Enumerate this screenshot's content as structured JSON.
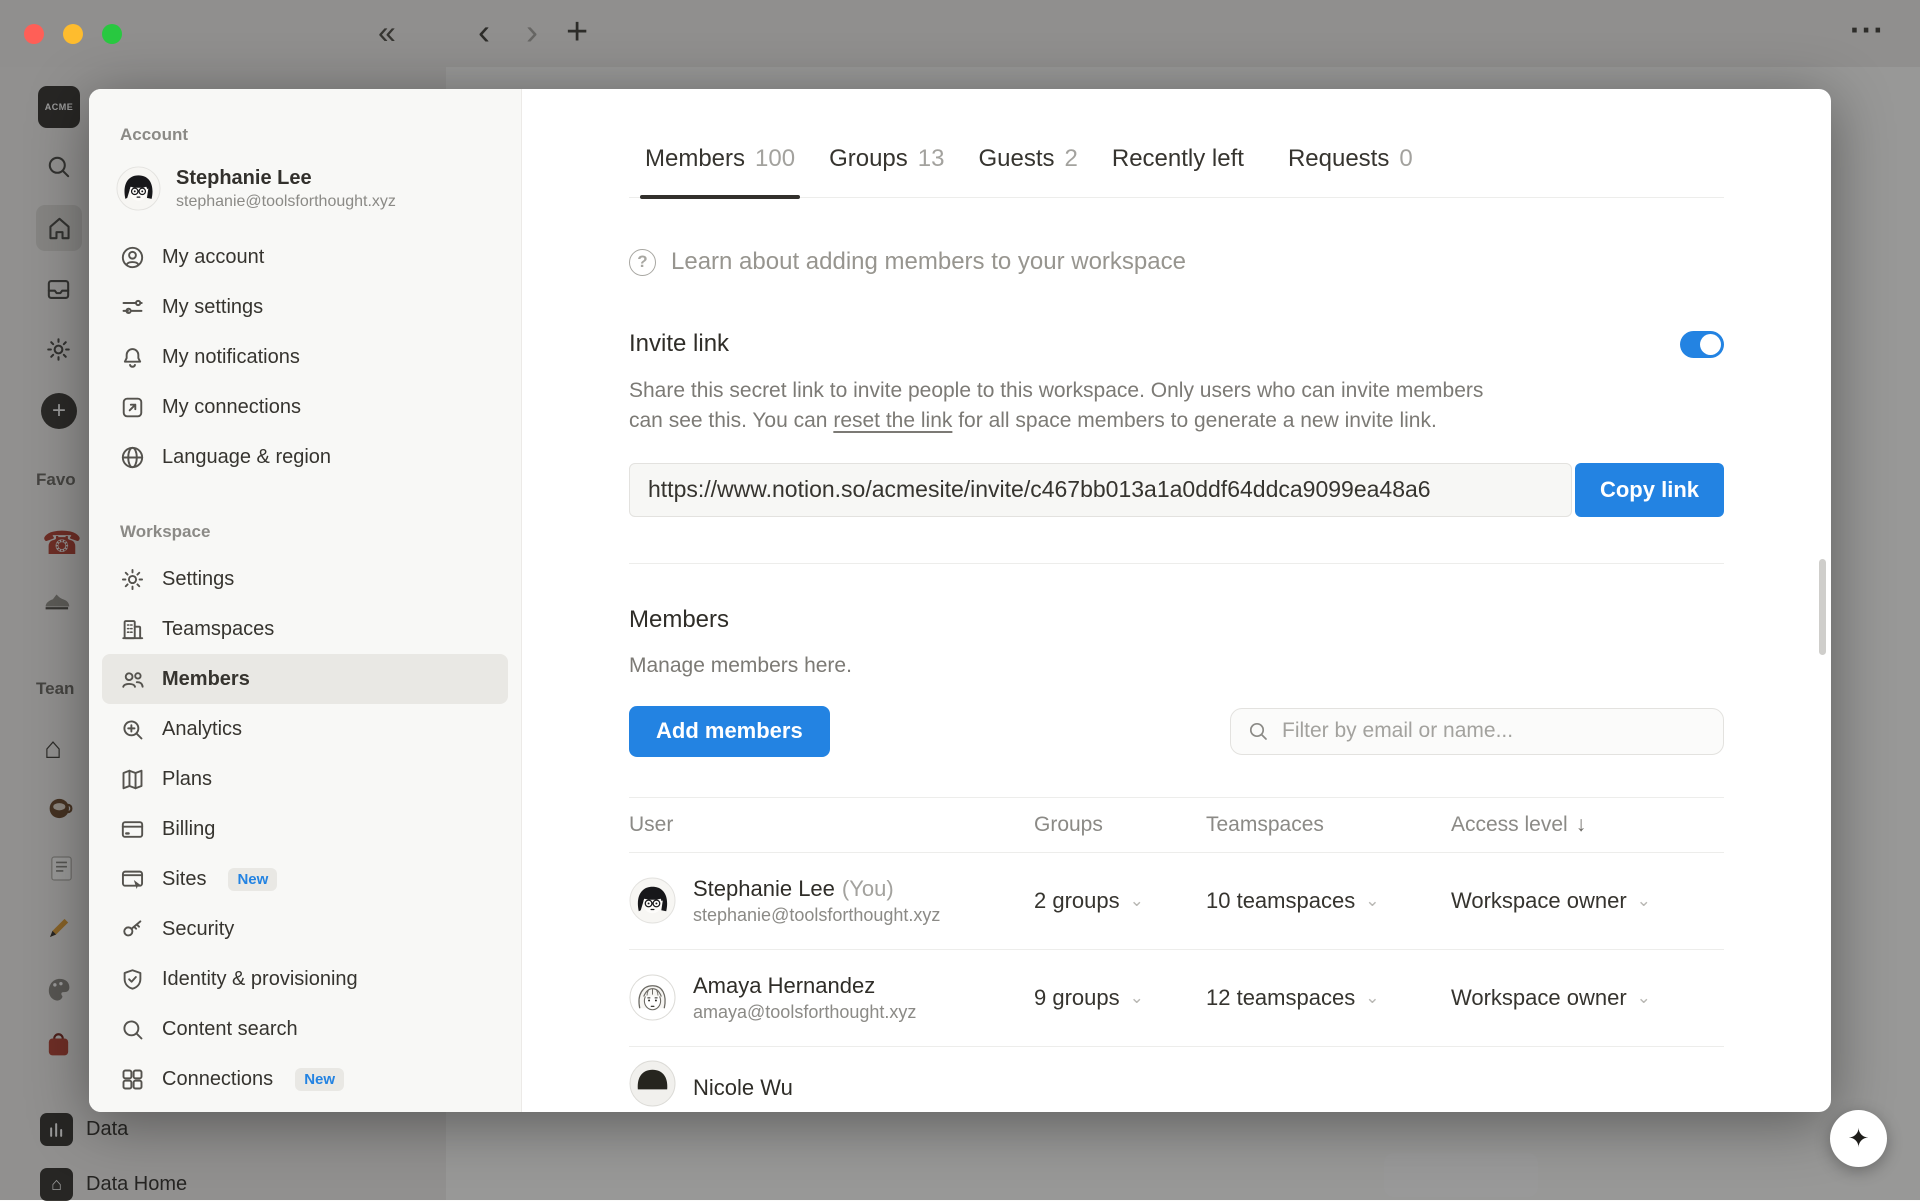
{
  "chrome": {
    "logo": "ACME",
    "collapse_icon": "«",
    "back_icon": "‹",
    "forward_icon": "›",
    "new_tab_icon": "+",
    "more_icon": "···",
    "plus_icon": "+",
    "favorites_label": "Favo",
    "teamspaces_label": "Tean",
    "data_label": "Data",
    "data_home_label": "Data Home",
    "phone_icon": "☎",
    "house_icon": "⌂",
    "sparkle_icon": "✦"
  },
  "sidebar": {
    "account_label": "Account",
    "user": {
      "name": "Stephanie Lee",
      "email": "stephanie@toolsforthought.xyz"
    },
    "account_items": [
      {
        "label": "My account",
        "icon": "person-circle-icon"
      },
      {
        "label": "My settings",
        "icon": "sliders-icon"
      },
      {
        "label": "My notifications",
        "icon": "bell-icon"
      },
      {
        "label": "My connections",
        "icon": "arrow-out-box-icon"
      },
      {
        "label": "Language & region",
        "icon": "globe-icon"
      }
    ],
    "workspace_label": "Workspace",
    "workspace_items": [
      {
        "label": "Settings",
        "icon": "gear-icon"
      },
      {
        "label": "Teamspaces",
        "icon": "building-icon"
      },
      {
        "label": "Members",
        "icon": "people-icon",
        "selected": true
      },
      {
        "label": "Analytics",
        "icon": "chart-search-icon"
      },
      {
        "label": "Plans",
        "icon": "map-icon"
      },
      {
        "label": "Billing",
        "icon": "credit-card-icon"
      },
      {
        "label": "Sites",
        "icon": "browser-cursor-icon",
        "badge": "New"
      },
      {
        "label": "Security",
        "icon": "key-icon"
      },
      {
        "label": "Identity & provisioning",
        "icon": "shield-check-icon"
      },
      {
        "label": "Content search",
        "icon": "search-icon"
      },
      {
        "label": "Connections",
        "icon": "grid-icon",
        "badge": "New"
      }
    ]
  },
  "main": {
    "tabs": [
      {
        "label": "Members",
        "count": "100",
        "active": true
      },
      {
        "label": "Groups",
        "count": "13"
      },
      {
        "label": "Guests",
        "count": "2"
      },
      {
        "label": "Recently left",
        "count": ""
      },
      {
        "label": "Requests",
        "count": "0"
      }
    ],
    "help_icon": "?",
    "help_text": "Learn about adding members to your workspace",
    "invite": {
      "title": "Invite link",
      "toggle_on": true,
      "desc_before": "Share this secret link to invite people to this workspace. Only users who can invite members can see this. You can ",
      "desc_link": "reset the link",
      "desc_after": " for all space members to generate a new invite link.",
      "url": "https://www.notion.so/acmesite/invite/c467bb013a1a0ddf64ddca9099ea48a6",
      "copy_label": "Copy link"
    },
    "members": {
      "title": "Members",
      "subtitle": "Manage members here.",
      "add_label": "Add members",
      "filter_placeholder": "Filter by email or name..."
    },
    "table": {
      "headers": {
        "user": "User",
        "groups": "Groups",
        "teamspaces": "Teamspaces",
        "access": "Access level"
      },
      "sort_icon": "↓",
      "chevron_icon": "⌄",
      "rows": [
        {
          "name": "Stephanie Lee",
          "suffix": "(You)",
          "email": "stephanie@toolsforthought.xyz",
          "groups": "2 groups",
          "teamspaces": "10 teamspaces",
          "access": "Workspace owner"
        },
        {
          "name": "Amaya Hernandez",
          "email": "amaya@toolsforthought.xyz",
          "groups": "9 groups",
          "teamspaces": "12 teamspaces",
          "access": "Workspace owner"
        },
        {
          "name": "Nicole Wu"
        }
      ]
    }
  },
  "colors": {
    "accent": "#2383e2"
  }
}
